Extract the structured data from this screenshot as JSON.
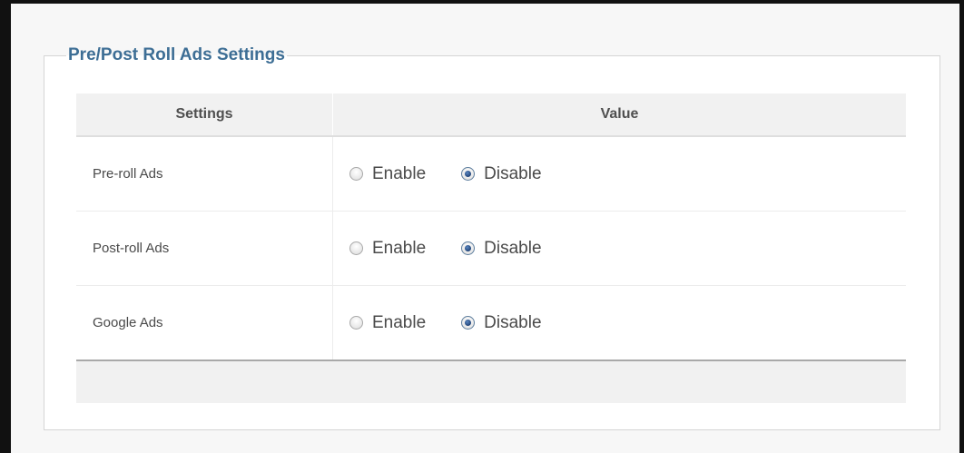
{
  "panel": {
    "title": "Pre/Post Roll Ads Settings"
  },
  "table": {
    "headers": {
      "settings": "Settings",
      "value": "Value"
    },
    "rows": [
      {
        "label": "Pre-roll Ads",
        "options": [
          {
            "label": "Enable",
            "checked": false
          },
          {
            "label": "Disable",
            "checked": true
          }
        ]
      },
      {
        "label": "Post-roll Ads",
        "options": [
          {
            "label": "Enable",
            "checked": false
          },
          {
            "label": "Disable",
            "checked": true
          }
        ]
      },
      {
        "label": "Google Ads",
        "options": [
          {
            "label": "Enable",
            "checked": false
          },
          {
            "label": "Disable",
            "checked": true
          }
        ]
      }
    ]
  }
}
